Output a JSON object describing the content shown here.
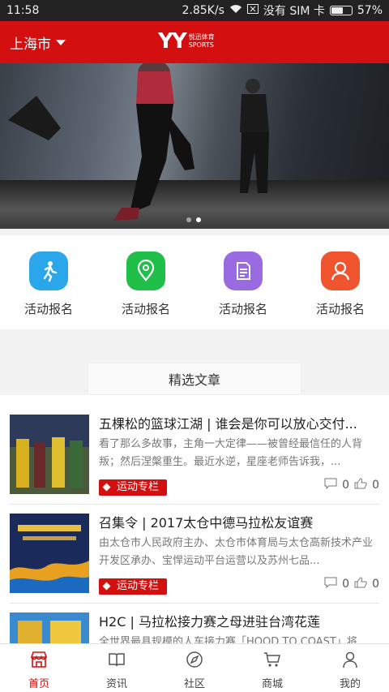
{
  "statusbar": {
    "time": "11:58",
    "speed": "2.85K/s",
    "carrier": "没有 SIM 卡",
    "battery": "57%",
    "battery_level": 0.57
  },
  "header": {
    "city": "上海市",
    "logo_mark": "YY",
    "logo_cn": "悦迅体育",
    "logo_en": "SPORTS"
  },
  "banner": {
    "slides": 2,
    "active_slide": 2
  },
  "quick_actions": [
    {
      "label": "活动报名",
      "icon": "runner-icon",
      "color": "#2aa7ea"
    },
    {
      "label": "活动报名",
      "icon": "location-pin-icon",
      "color": "#1fbf4a"
    },
    {
      "label": "活动报名",
      "icon": "document-icon",
      "color": "#9a6ae0"
    },
    {
      "label": "活动报名",
      "icon": "person-icon",
      "color": "#f0542e"
    }
  ],
  "section": {
    "title": "精选文章"
  },
  "articles": [
    {
      "title": "五棵松的篮球江湖 | 谁会是你可以放心交付...",
      "desc": "看了那么多故事，主角一大定律——被曾经最信任的人背叛；然后涅槃重生。最近水逆，星座老师告诉我，...",
      "tag": "运动专栏",
      "comments": "0",
      "likes": "0"
    },
    {
      "title": "召集令 | 2017太仓中德马拉松友谊赛",
      "desc": "由太仓市人民政府主办、太仓市体育局与太仓高新技术产业开发区承办、宝悍运动平台运营以及苏州七品...",
      "tag": "运动专栏",
      "comments": "0",
      "likes": "0"
    },
    {
      "title": "H2C | 马拉松接力赛之母进驻台湾花莲",
      "desc": "全世界最具规模的人车接力赛「HOOD TO COAST」将",
      "tag": "",
      "comments": "",
      "likes": ""
    }
  ],
  "tabbar": [
    {
      "label": "首页",
      "icon": "home-store-icon",
      "active": true
    },
    {
      "label": "资讯",
      "icon": "book-icon",
      "active": false
    },
    {
      "label": "社区",
      "icon": "compass-icon",
      "active": false
    },
    {
      "label": "商城",
      "icon": "cart-icon",
      "active": false
    },
    {
      "label": "我的",
      "icon": "user-icon",
      "active": false
    }
  ],
  "colors": {
    "brand": "#d40f0f",
    "statusbar": "#222222"
  }
}
